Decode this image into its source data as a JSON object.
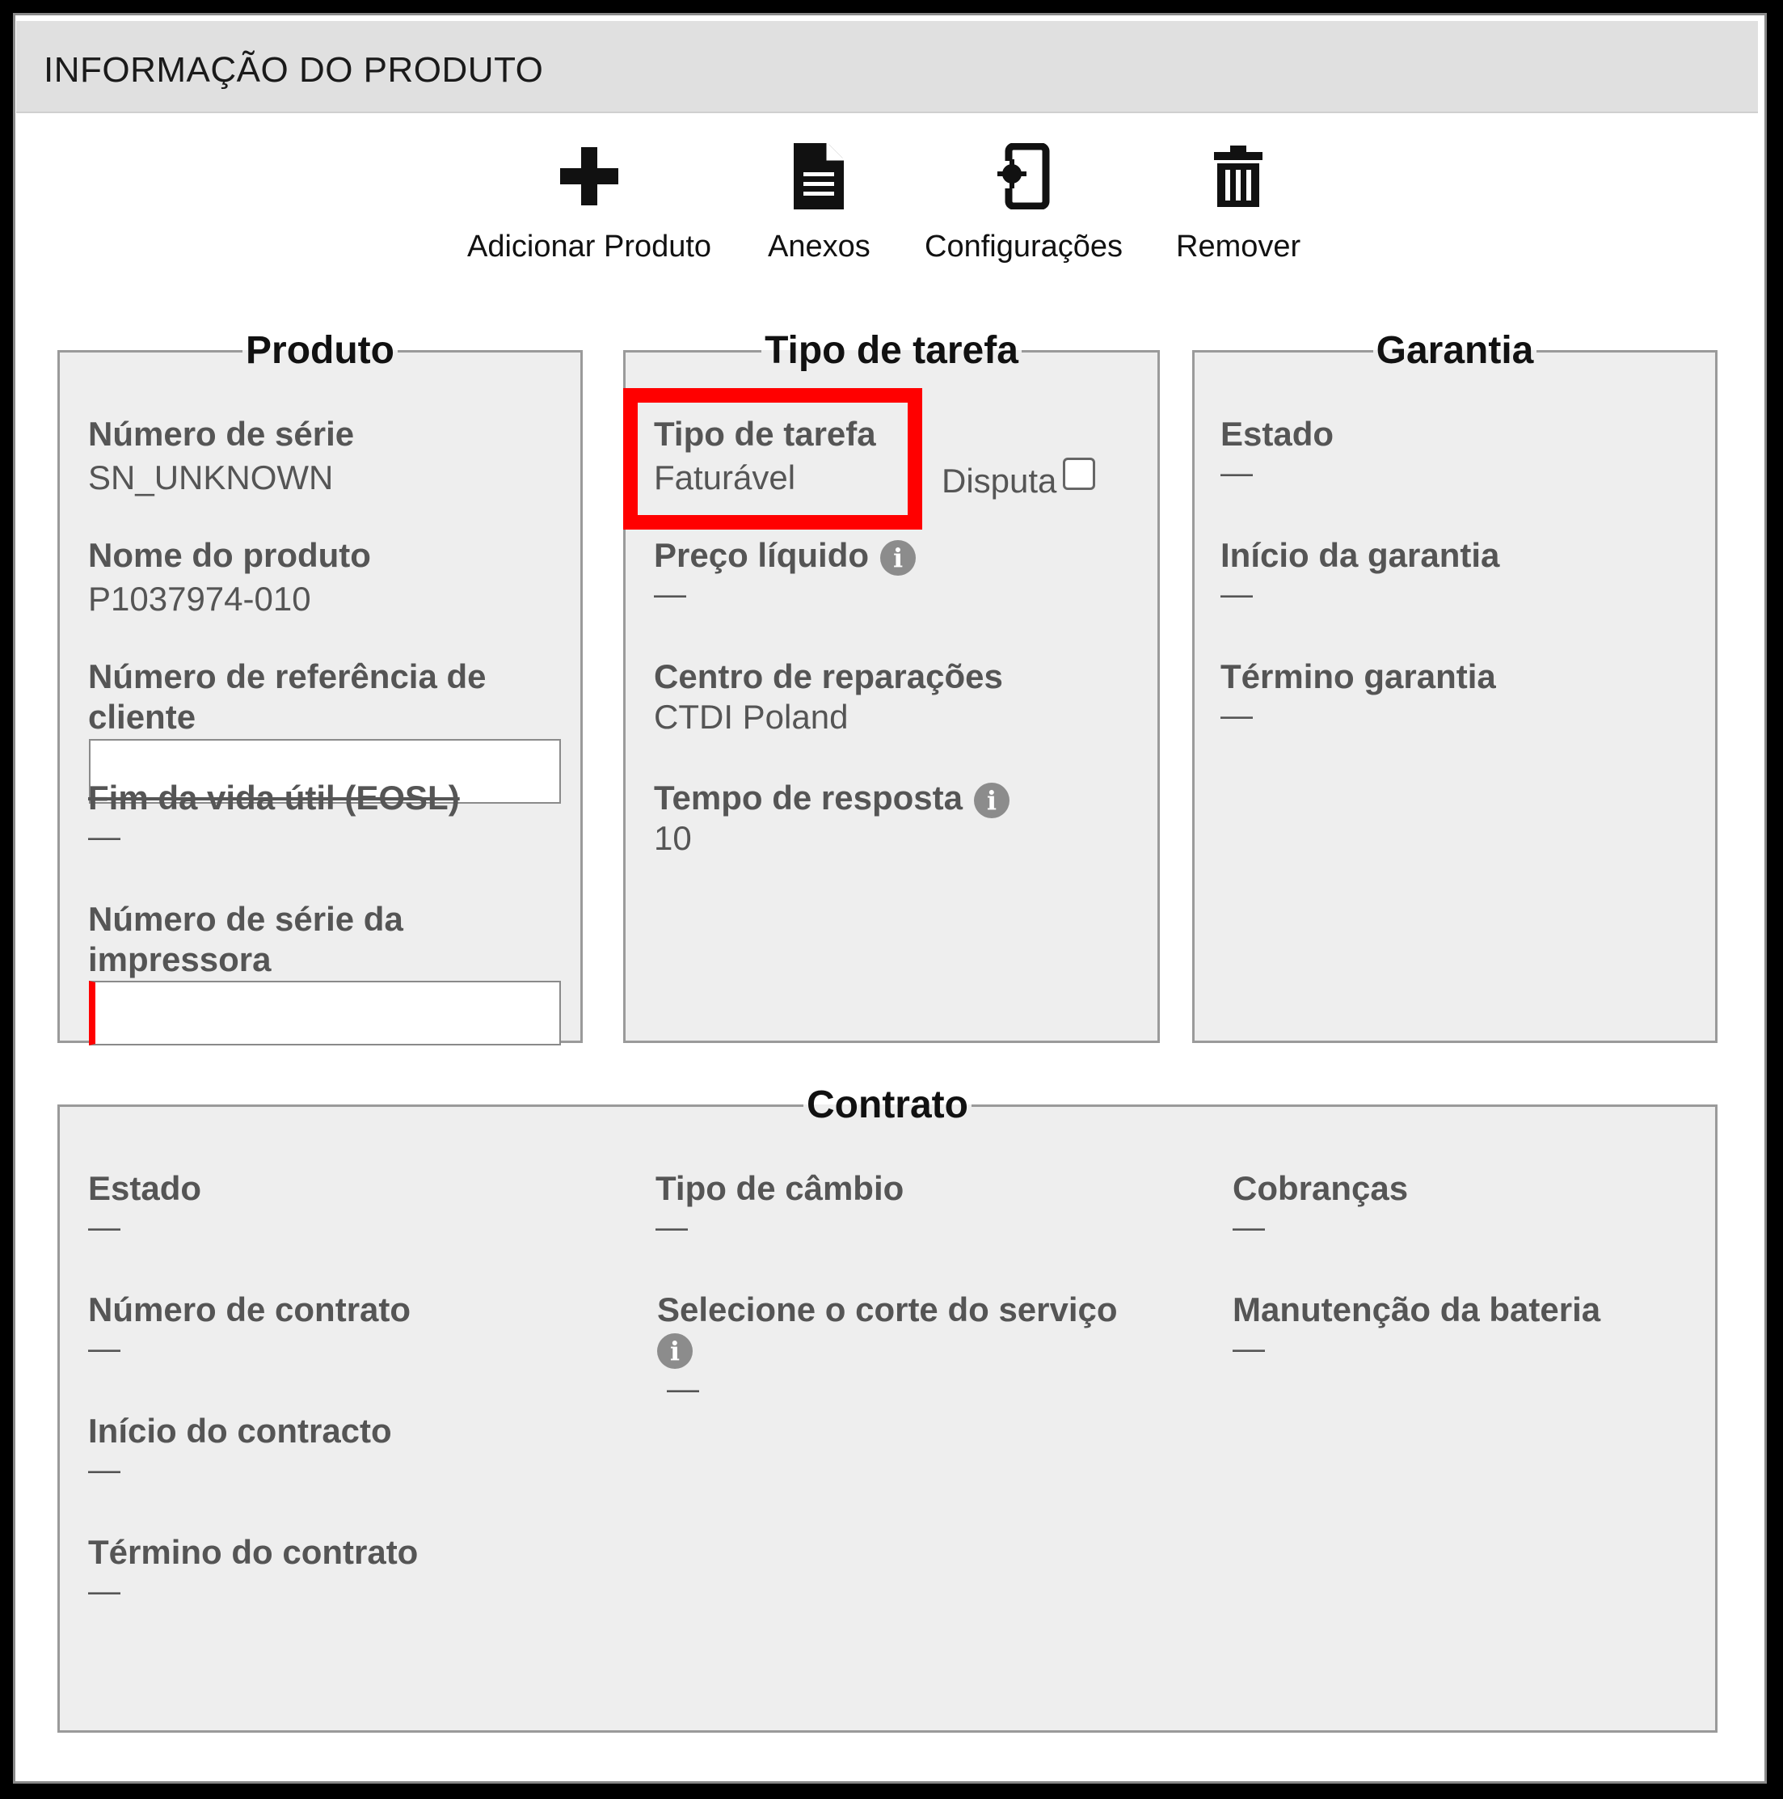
{
  "header": {
    "title": "INFORMAÇÃO DO PRODUTO"
  },
  "toolbar": {
    "add_label": "Adicionar Produto",
    "attachments_label": "Anexos",
    "settings_label": "Configurações",
    "remove_label": "Remover"
  },
  "produto": {
    "legend": "Produto",
    "serial_label": "Número de série",
    "serial_value": "SN_UNKNOWN",
    "name_label": "Nome do produto",
    "name_value": "P1037974-010",
    "customer_ref_label": "Número de referência de cliente",
    "customer_ref_value": "",
    "eosl_label": "Fim da vida útil (EOSL)",
    "eosl_value": "—",
    "printer_serial_label": "Número de série da impressora",
    "printer_serial_value": ""
  },
  "tarefa": {
    "legend": "Tipo de tarefa",
    "type_label": "Tipo de tarefa",
    "type_value": "Faturável",
    "dispute_label": "Disputa",
    "net_price_label": "Preço líquido",
    "net_price_value": "—",
    "repair_center_label": "Centro de reparações",
    "repair_center_value": "CTDI Poland",
    "response_time_label": "Tempo de resposta",
    "response_time_value": "10"
  },
  "garantia": {
    "legend": "Garantia",
    "state_label": "Estado",
    "state_value": "—",
    "start_label": "Início da garantia",
    "start_value": "—",
    "end_label": "Término garantia",
    "end_value": "—"
  },
  "contrato": {
    "legend": "Contrato",
    "state_label": "Estado",
    "state_value": "—",
    "number_label": "Número de contrato",
    "number_value": "—",
    "start_label": "Início do contracto",
    "start_value": "—",
    "end_label": "Término do contrato",
    "end_value": "—",
    "exchange_label": "Tipo de câmbio",
    "exchange_value": "—",
    "service_cut_label": "Selecione o corte do serviço",
    "service_cut_value": "—",
    "charges_label": "Cobranças",
    "charges_value": "—",
    "battery_label": "Manutenção da bateria",
    "battery_value": "—"
  },
  "icons": {
    "add": "plus-icon",
    "attachments": "document-icon",
    "settings": "device-settings-icon",
    "remove": "trash-icon",
    "info": "info-icon"
  },
  "colors": {
    "highlight": "#ff0000",
    "panel_bg": "#eeeeee",
    "header_bg": "#e0e0e0",
    "required_marker": "#ff0000"
  }
}
